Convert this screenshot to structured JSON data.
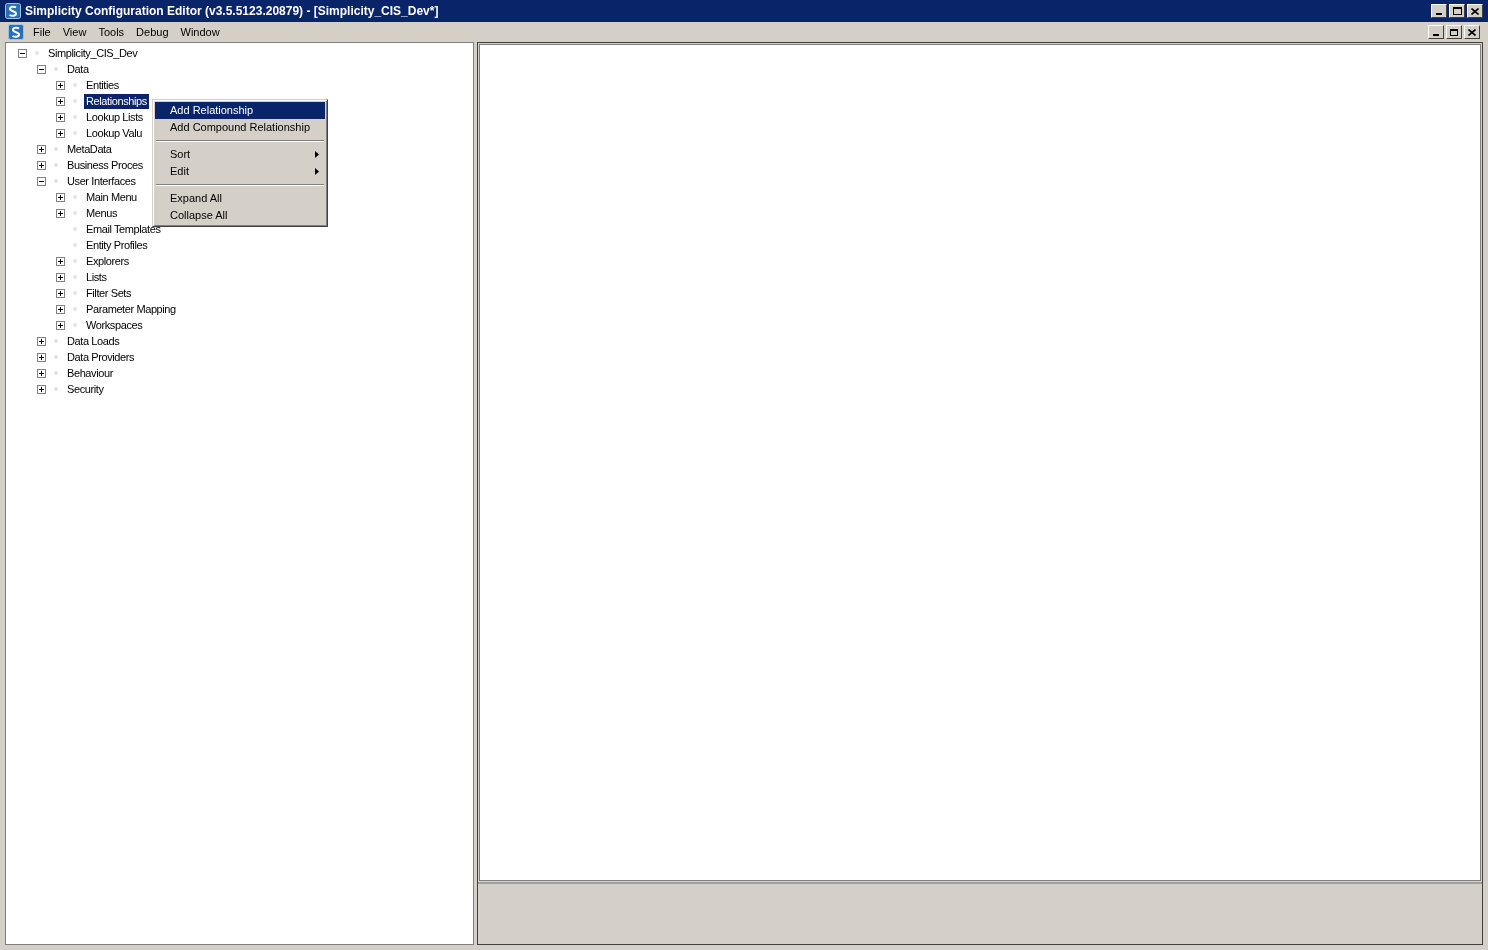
{
  "window": {
    "title": "Simplicity Configuration Editor (v3.5.5123.20879) - [Simplicity_CIS_Dev*]"
  },
  "menu_bar": [
    "File",
    "View",
    "Tools",
    "Debug",
    "Window"
  ],
  "tree": [
    {
      "label": "Simplicity_CIS_Dev",
      "expandable": true,
      "expanded": true,
      "selected": false,
      "children": [
        {
          "label": "Data",
          "expandable": true,
          "expanded": true,
          "selected": false,
          "children": [
            {
              "label": "Entities",
              "expandable": true,
              "expanded": false,
              "selected": false
            },
            {
              "label": "Relationships",
              "expandable": true,
              "expanded": false,
              "selected": true
            },
            {
              "label": "Lookup Lists",
              "expandable": true,
              "expanded": false,
              "selected": false
            },
            {
              "label": "Lookup Valu",
              "expandable": true,
              "expanded": false,
              "selected": false
            }
          ]
        },
        {
          "label": "MetaData",
          "expandable": true,
          "expanded": false,
          "selected": false
        },
        {
          "label": "Business Proces",
          "expandable": true,
          "expanded": false,
          "selected": false
        },
        {
          "label": "User Interfaces",
          "expandable": true,
          "expanded": true,
          "selected": false,
          "children": [
            {
              "label": "Main Menu",
              "expandable": true,
              "expanded": false,
              "selected": false
            },
            {
              "label": "Menus",
              "expandable": true,
              "expanded": false,
              "selected": false
            },
            {
              "label": "Email Templates",
              "selected": false
            },
            {
              "label": "Entity Profiles",
              "selected": false
            },
            {
              "label": "Explorers",
              "expandable": true,
              "expanded": false,
              "selected": false
            },
            {
              "label": "Lists",
              "expandable": true,
              "expanded": false,
              "selected": false
            },
            {
              "label": "Filter Sets",
              "expandable": true,
              "expanded": false,
              "selected": false
            },
            {
              "label": "Parameter Mapping",
              "expandable": true,
              "expanded": false,
              "selected": false
            },
            {
              "label": "Workspaces",
              "expandable": true,
              "expanded": false,
              "selected": false
            }
          ]
        },
        {
          "label": "Data Loads",
          "expandable": true,
          "expanded": false,
          "selected": false
        },
        {
          "label": "Data Providers",
          "expandable": true,
          "expanded": false,
          "selected": false
        },
        {
          "label": "Behaviour",
          "expandable": true,
          "expanded": false,
          "selected": false
        },
        {
          "label": "Security",
          "expandable": true,
          "expanded": false,
          "selected": false
        }
      ]
    }
  ],
  "context_menu": [
    {
      "kind": "item",
      "label": "Add Relationship",
      "selected": true,
      "submenu": false
    },
    {
      "kind": "item",
      "label": "Add Compound Relationship",
      "selected": false,
      "submenu": false
    },
    {
      "kind": "separator"
    },
    {
      "kind": "item",
      "label": "Sort",
      "selected": false,
      "submenu": true
    },
    {
      "kind": "item",
      "label": "Edit",
      "selected": false,
      "submenu": true
    },
    {
      "kind": "separator"
    },
    {
      "kind": "item",
      "label": "Expand All",
      "selected": false,
      "submenu": false
    },
    {
      "kind": "item",
      "label": "Collapse All",
      "selected": false,
      "submenu": false
    }
  ]
}
